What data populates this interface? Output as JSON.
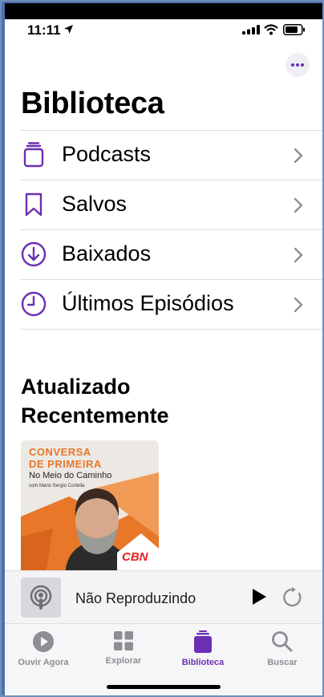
{
  "status": {
    "time": "11:11"
  },
  "header": {
    "title": "Biblioteca",
    "more_icon": "ellipsis-icon"
  },
  "menu": [
    {
      "label": "Podcasts",
      "icon": "stack-icon"
    },
    {
      "label": "Salvos",
      "icon": "bookmark-icon"
    },
    {
      "label": "Baixados",
      "icon": "download-icon"
    },
    {
      "label": "Últimos Episódios",
      "icon": "clock-icon"
    }
  ],
  "recent": {
    "title": "Atualizado Recentemente",
    "items": [
      {
        "line1": "CONVERSA",
        "line2": "DE PRIMEIRA",
        "subtitle": "No Meio do Caminho",
        "credit": "com Mario Sergio Cortella",
        "brand": "CBN"
      }
    ]
  },
  "miniplayer": {
    "label": "Não Reproduzindo"
  },
  "tabs": [
    {
      "label": "Ouvir Agora",
      "icon": "play-circle-icon",
      "active": false
    },
    {
      "label": "Explorar",
      "icon": "grid-icon",
      "active": false
    },
    {
      "label": "Biblioteca",
      "icon": "library-icon",
      "active": true
    },
    {
      "label": "Buscar",
      "icon": "search-icon",
      "active": false
    }
  ],
  "colors": {
    "accent": "#6b2fb3",
    "inactive": "#8e8e93",
    "orange": "#e8772a"
  }
}
